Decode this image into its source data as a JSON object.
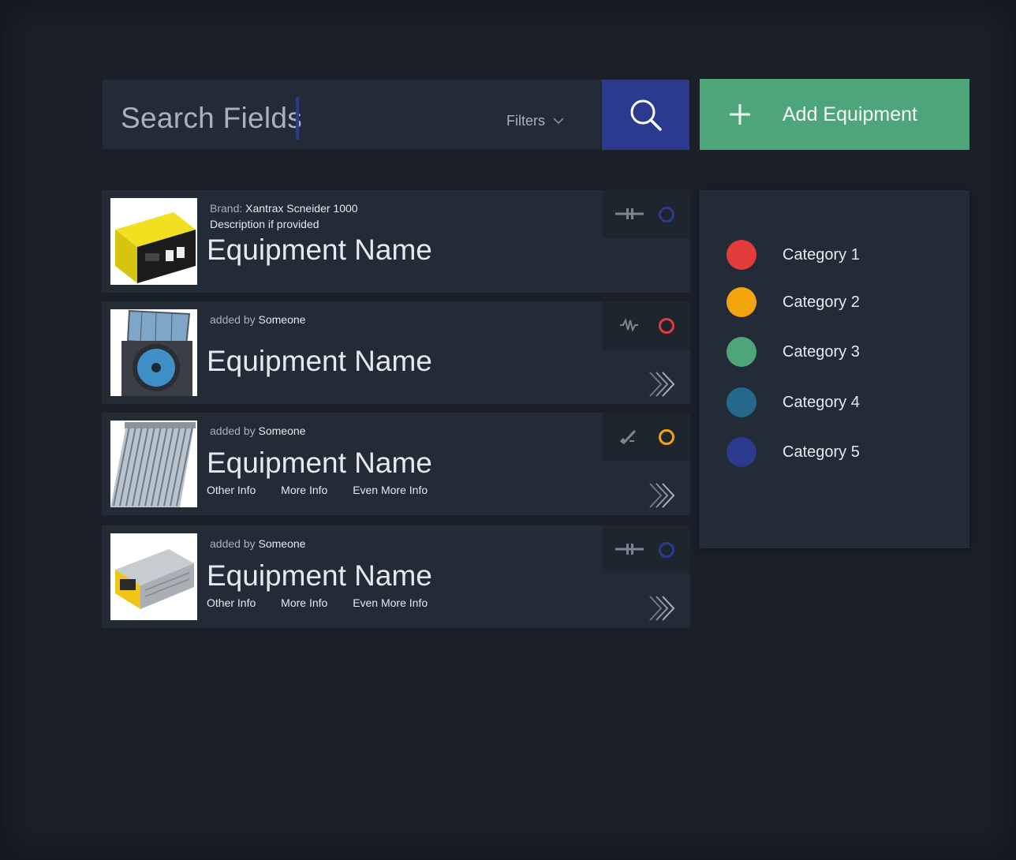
{
  "search": {
    "placeholder": "Search Fields",
    "filters_label": "Filters"
  },
  "add_button": {
    "label": "Add Equipment"
  },
  "colors": {
    "accent_blue": "#2b3a8f",
    "green": "#4fa57a",
    "card_bg": "#232b36",
    "page_bg": "#1a1f28"
  },
  "cards": [
    {
      "meta_prefix": "Brand:",
      "meta_value": "Xantrax Scneider 1000",
      "description": "Description if provided",
      "name": "Equipment Name",
      "type_icon": "plug-icon",
      "status_color": "#2b3a8f"
    },
    {
      "meta_prefix": "added by",
      "meta_value": "Someone",
      "name": "Equipment Name",
      "type_icon": "waveform-icon",
      "status_color": "#e23b3b"
    },
    {
      "meta_prefix": "added by",
      "meta_value": "Someone",
      "name": "Equipment Name",
      "info": [
        "Other Info",
        "More Info",
        "Even More Info"
      ],
      "type_icon": "wrench-icon",
      "status_color": "#f4a40c"
    },
    {
      "meta_prefix": "added by",
      "meta_value": "Someone",
      "name": "Equipment Name",
      "info": [
        "Other Info",
        "More Info",
        "Even More Info"
      ],
      "type_icon": "plug-icon",
      "status_color": "#2b3a8f"
    }
  ],
  "legend": {
    "items": [
      {
        "label": "Category 1",
        "color": "#e23b3b"
      },
      {
        "label": "Category 2",
        "color": "#f4a40c"
      },
      {
        "label": "Category 3",
        "color": "#4fa57a"
      },
      {
        "label": "Category 4",
        "color": "#24698c"
      },
      {
        "label": "Category 5",
        "color": "#2b3a8f"
      }
    ]
  }
}
